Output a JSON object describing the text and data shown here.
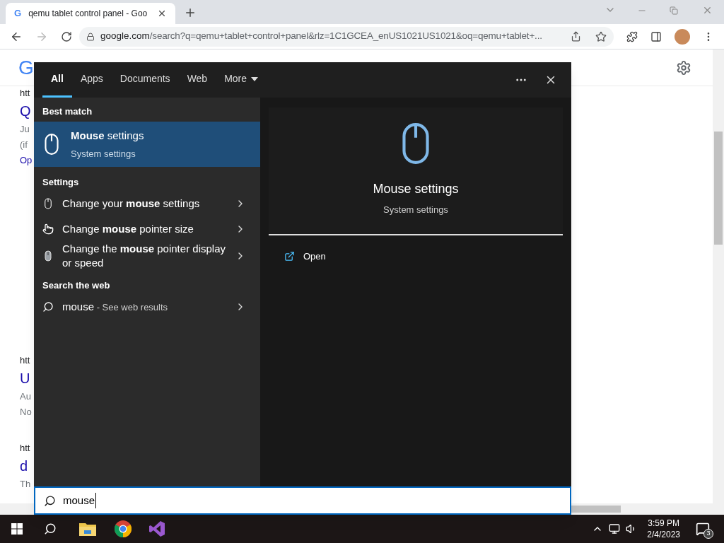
{
  "browser": {
    "tab_title": "qemu tablet control panel - Goo",
    "url_host": "google.com",
    "url_rest": "/search?q=qemu+tablet+control+panel&rlz=1C1GCEA_enUS1021US1021&oq=qemu+tablet+...",
    "favicon_letter": "G",
    "logo_letter": "G"
  },
  "results": [
    {
      "url": "htt",
      "title": "Q",
      "snippets": [
        "Ju",
        "(if"
      ],
      "link": "Op"
    },
    {
      "url": "htt",
      "title": "U",
      "snippets": [
        "Au",
        "No"
      ]
    },
    {
      "url": "htt",
      "title": "d",
      "snippets": [
        "Th"
      ]
    }
  ],
  "search": {
    "tabs": [
      {
        "label": "All",
        "selected": true,
        "dropdown": false
      },
      {
        "label": "Apps",
        "selected": false,
        "dropdown": false
      },
      {
        "label": "Documents",
        "selected": false,
        "dropdown": false
      },
      {
        "label": "Web",
        "selected": false,
        "dropdown": false
      },
      {
        "label": "More",
        "selected": false,
        "dropdown": true
      }
    ],
    "best_match": {
      "heading": "Best match",
      "title": "**Mouse** settings",
      "subtitle": "System settings",
      "selected": true
    },
    "sections": [
      {
        "heading": "Settings",
        "items": [
          {
            "kind": "mouse",
            "text": "Change your **mouse** settings"
          },
          {
            "kind": "pointer",
            "text": "Change **mouse** pointer size"
          },
          {
            "kind": "speed",
            "text": "Change the **mouse** pointer display or speed"
          }
        ]
      },
      {
        "heading": "Search the web",
        "items": [
          {
            "kind": "web",
            "text": "mouse",
            "suffix": "- See web results"
          }
        ]
      }
    ],
    "preview": {
      "title": "Mouse settings",
      "subtitle": "System settings",
      "actions": [
        "Open"
      ]
    },
    "query": "mouse"
  },
  "taskbar": {
    "time": "3:59 PM",
    "date": "2/4/2023",
    "notifications": "3"
  }
}
